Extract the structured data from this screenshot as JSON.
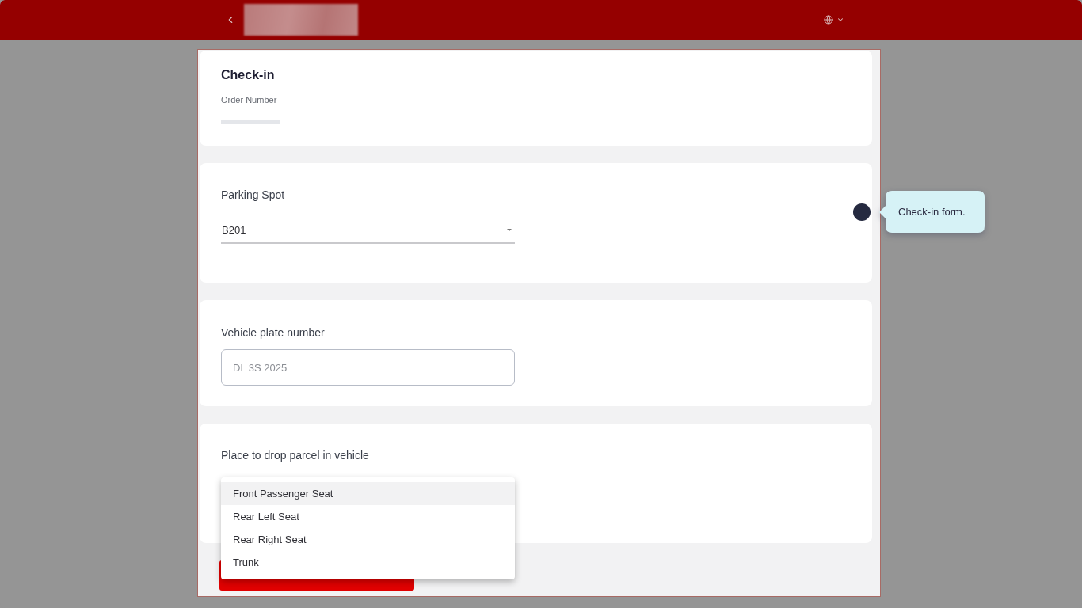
{
  "form": {
    "title": "Check-in",
    "order_number": {
      "label": "Order Number"
    },
    "parking_spot": {
      "label": "Parking Spot",
      "value": "B201"
    },
    "vehicle_plate": {
      "label": "Vehicle plate number",
      "placeholder": "DL 3S 2025"
    },
    "drop_place": {
      "label": "Place to drop parcel in vehicle",
      "expanded": true,
      "options": [
        {
          "label": "Front Passenger Seat",
          "selected": true
        },
        {
          "label": "Rear Left Seat",
          "selected": false
        },
        {
          "label": "Rear Right Seat",
          "selected": false
        },
        {
          "label": "Trunk",
          "selected": false
        }
      ]
    }
  },
  "tooltip": {
    "text": "Check-in form."
  }
}
